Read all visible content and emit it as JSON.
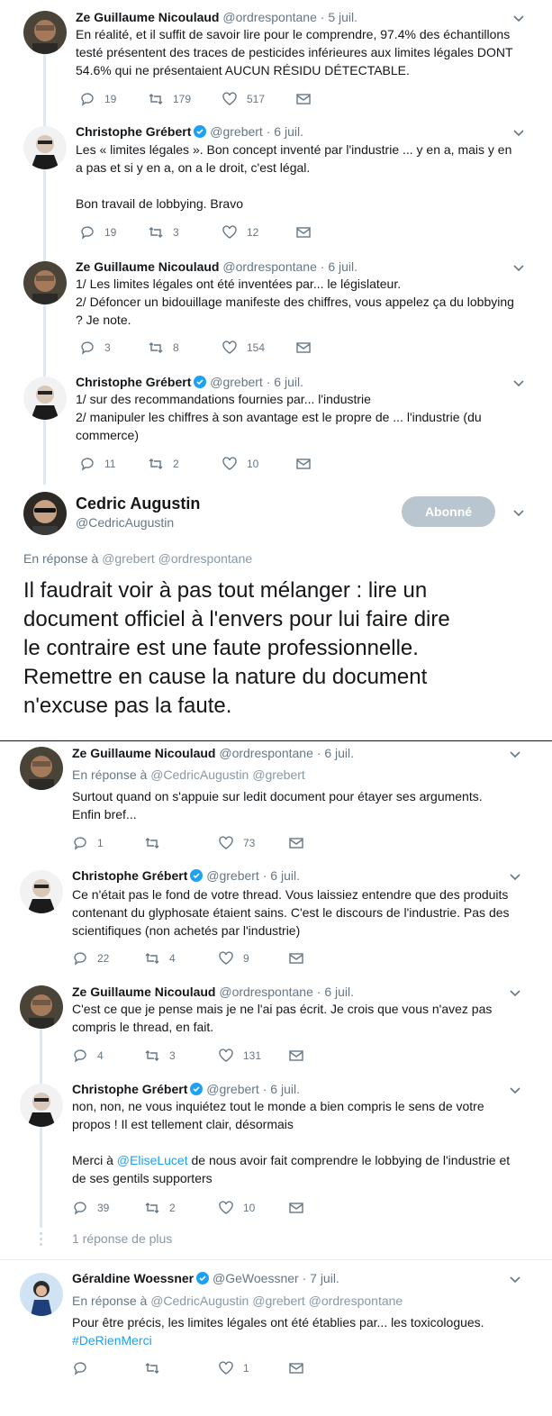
{
  "ancestors": [
    {
      "name": "Ze Guillaume Nicoulaud",
      "handle": "@ordrespontane",
      "time": "5 juil.",
      "verified": false,
      "lines": [
        "En réalité, et il suffit de savoir lire pour le comprendre, 97.4% des échantillons",
        "testé présentent des traces de pesticides inférieures aux limites légales DONT",
        "54.6% qui ne présentaient AUCUN RÉSIDU DÉTECTABLE."
      ],
      "replies": "19",
      "retweets": "179",
      "likes": "517"
    },
    {
      "name": "Christophe Grébert",
      "handle": "@grebert",
      "time": "6 juil.",
      "verified": true,
      "lines": [
        "Les « limites légales ». Bon concept inventé par l'industrie ... y en a, mais y en",
        "a pas et si y en a, on a le droit, c'est légal.",
        "",
        "Bon travail de lobbying. Bravo"
      ],
      "replies": "19",
      "retweets": "3",
      "likes": "12"
    },
    {
      "name": "Ze Guillaume Nicoulaud",
      "handle": "@ordrespontane",
      "time": "6 juil.",
      "verified": false,
      "lines": [
        "1/ Les limites légales ont été inventées par... le législateur.",
        "2/ Défoncer un bidouillage manifeste des chiffres, vous appelez ça du lobbying",
        "? Je note."
      ],
      "replies": "3",
      "retweets": "8",
      "likes": "154"
    },
    {
      "name": "Christophe Grébert",
      "handle": "@grebert",
      "time": "6 juil.",
      "verified": true,
      "lines": [
        "1/ sur des recommandations fournies par... l'industrie",
        "2/ manipuler les chiffres à son avantage est le propre de ... l'industrie (du",
        "commerce)"
      ],
      "replies": "11",
      "retweets": "2",
      "likes": "10"
    }
  ],
  "main": {
    "name": "Cedric Augustin",
    "handle": "@CedricAugustin",
    "follow_label": "Abonné",
    "reply_prefix": "En réponse à",
    "reply_to": "@grebert @ordrespontane",
    "lines": [
      "Il faudrait voir à pas tout mélanger : lire un",
      "document officiel à l'envers pour lui faire dire",
      "le contraire est une faute professionnelle.",
      "Remettre en cause la nature du document",
      "n'excuse pas la faute."
    ]
  },
  "replies": [
    {
      "name": "Ze Guillaume Nicoulaud",
      "handle": "@ordrespontane",
      "time": "6 juil.",
      "verified": false,
      "reply_prefix": "En réponse à",
      "reply_to": "@CedricAugustin @grebert",
      "lines": [
        "Surtout quand on s'appuie sur ledit document pour étayer ses arguments.",
        "Enfin bref..."
      ],
      "replies": "1",
      "retweets": "",
      "likes": "73"
    },
    {
      "name": "Christophe Grébert",
      "handle": "@grebert",
      "time": "6 juil.",
      "verified": true,
      "lines": [
        "Ce n'était pas le fond de votre thread. Vous laissiez entendre que des produits",
        "contenant du glyphosate étaient sains. C'est le discours de l'industrie. Pas des",
        "scientifiques (non achetés par l'industrie)"
      ],
      "replies": "22",
      "retweets": "4",
      "likes": "9"
    },
    {
      "name": "Ze Guillaume Nicoulaud",
      "handle": "@ordrespontane",
      "time": "6 juil.",
      "verified": false,
      "lines": [
        "C'est ce que je pense mais je ne l'ai pas écrit. Je crois que vous n'avez pas",
        "compris le thread, en fait."
      ],
      "replies": "4",
      "retweets": "3",
      "likes": "131"
    },
    {
      "name": "Christophe Grébert",
      "handle": "@grebert",
      "time": "6 juil.",
      "verified": true,
      "lines": [
        "non, non, ne vous inquiétez tout le monde a bien compris le sens de votre",
        "propos ! Il est tellement clair, désormais",
        ""
      ],
      "mention_line": {
        "prefix": "Merci à ",
        "mention": "@EliseLucet",
        "suffix": " de nous avoir fait comprendre le lobbying de l'industrie et"
      },
      "last_line": "de ses gentils supporters",
      "replies": "39",
      "retweets": "2",
      "likes": "10"
    },
    {
      "name": "Géraldine Woessner",
      "handle": "@GeWoessner",
      "time": "7 juil.",
      "verified": true,
      "reply_prefix": "En réponse à",
      "reply_to": "@CedricAugustin @grebert @ordrespontane",
      "lines": [
        "Pour être précis, les limites légales ont été établies par... les toxicologues."
      ],
      "hashtag": "#DeRienMerci",
      "replies": "",
      "retweets": "",
      "likes": "1"
    }
  ],
  "more_replies": "1 réponse de plus",
  "separator": "·",
  "colors": {
    "accent": "#1da1f2",
    "muted": "#657786",
    "follow_bg": "#b9c5cf"
  }
}
